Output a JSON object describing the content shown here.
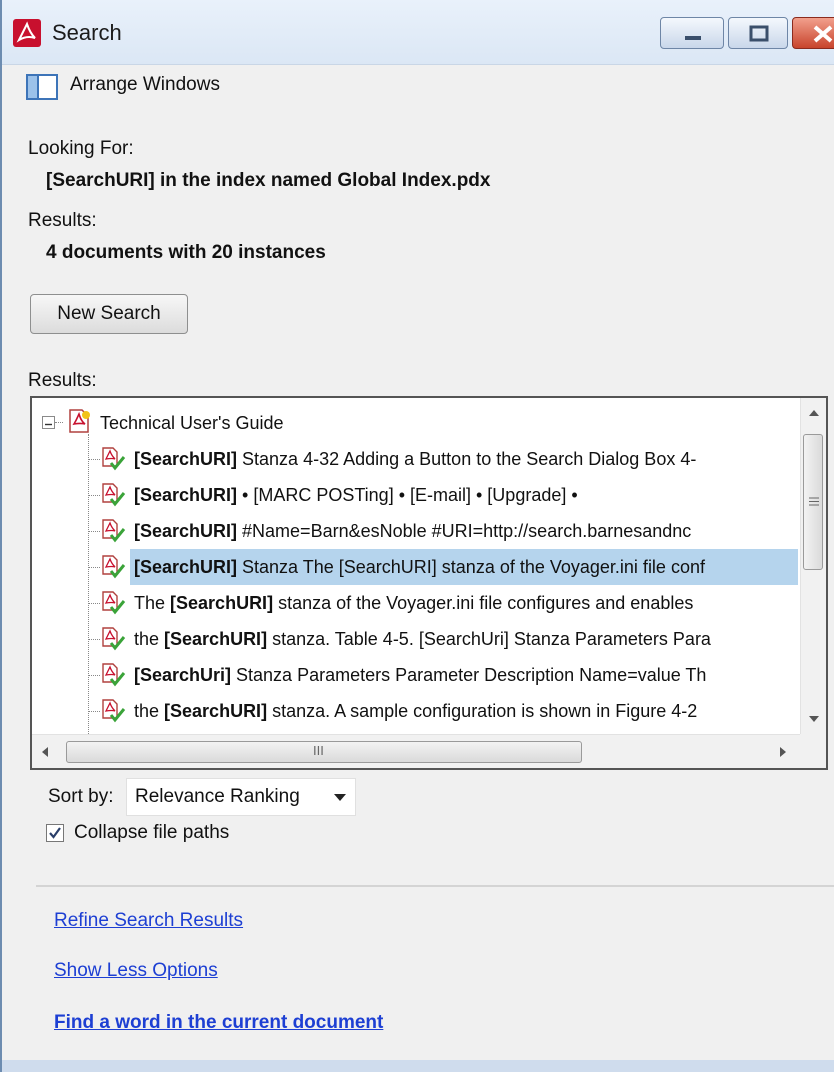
{
  "window": {
    "title": "Search",
    "icon": "acrobat-icon",
    "controls": [
      "minimize-icon",
      "maximize-icon",
      "close-icon"
    ]
  },
  "arrange": {
    "label": "Arrange Windows",
    "icon": "arrange-windows-icon"
  },
  "looking_for": {
    "label": "Looking For:",
    "value": "[SearchURI] in the index named Global Index.pdx"
  },
  "summary": {
    "label": "Results:",
    "value": "4 documents with 20 instances"
  },
  "new_search_button": "New Search",
  "results_label": "Results:",
  "tree": {
    "root": {
      "label": "Technical User's Guide",
      "icon": "pdf-document-icon"
    },
    "items": [
      {
        "pre": "",
        "bold": "[SearchURI]",
        "post": " Stanza 4-32 Adding a Button to the Search Dialog Box 4-"
      },
      {
        "pre": "",
        "bold": "[SearchURI]",
        "post": " • [MARC POSTing] • [E-mail] • [Upgrade] •"
      },
      {
        "pre": "",
        "bold": "[SearchURI]",
        "post": " #Name=Barn&esNoble #URI=http://search.barnesandnc"
      },
      {
        "pre": "",
        "bold": "[SearchURI]",
        "post": " Stanza The [SearchURI] stanza of the Voyager.ini file conf"
      },
      {
        "pre": "The ",
        "bold": "[SearchURI]",
        "post": " stanza of the Voyager.ini file configures and enables"
      },
      {
        "pre": "the ",
        "bold": "[SearchURI]",
        "post": " stanza. Table 4-5. [SearchUri] Stanza Parameters Para"
      },
      {
        "pre": "",
        "bold": "[SearchUri]",
        "post": " Stanza Parameters Parameter Description Name=value Th"
      },
      {
        "pre": "the ",
        "bold": "[SearchURI]",
        "post": " stanza. A sample configuration is shown in Figure 4-2"
      }
    ],
    "selected_index": 3,
    "result_icon": "search-hit-document-icon",
    "hscroll_grip": "III"
  },
  "sort": {
    "label": "Sort by:",
    "value": "Relevance Ranking"
  },
  "collapse": {
    "label": "Collapse file paths",
    "checked": true
  },
  "links": {
    "refine": "Refine Search Results",
    "less": "Show Less Options",
    "find": "Find a word in the current document"
  },
  "colors": {
    "selection": "#b5d4ed",
    "link": "#1d3fd3",
    "close_button": "#c8442c"
  }
}
